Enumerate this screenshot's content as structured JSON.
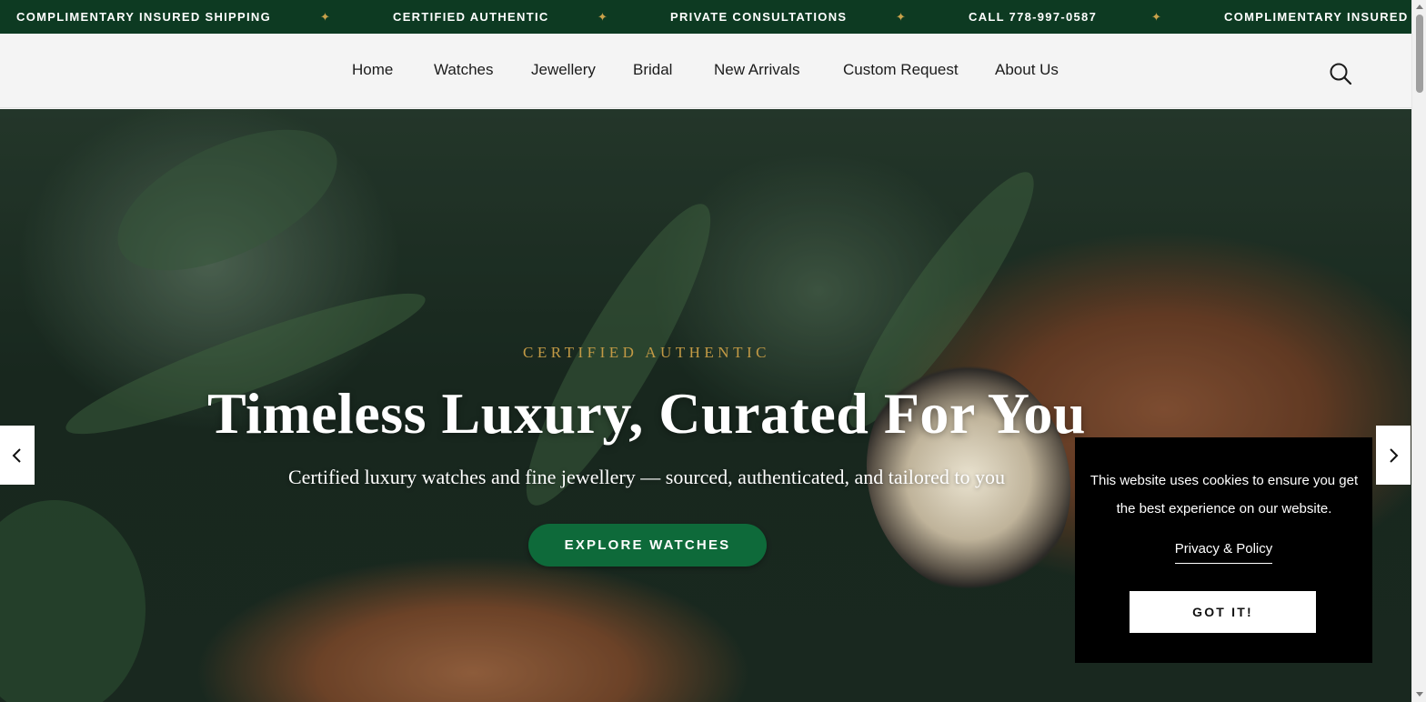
{
  "announcement": {
    "items": [
      "COMPLIMENTARY INSURED SHIPPING",
      "CERTIFIED AUTHENTIC",
      "PRIVATE CONSULTATIONS",
      "CALL 778-997-0587",
      "COMPLIMENTARY INSURED S"
    ],
    "separator": "✦",
    "background": "#0d3a22",
    "separator_color": "#c9a24b"
  },
  "nav": {
    "items": [
      "Home",
      "Watches",
      "Jewellery",
      "Bridal",
      "New Arrivals",
      "Custom Request",
      "About Us"
    ],
    "search_icon": "search-icon"
  },
  "hero": {
    "eyebrow": "CERTIFIED AUTHENTIC",
    "headline": "Timeless Luxury, Curated For You",
    "subline": "Certified luxury watches and fine jewellery — sourced, authenticated, and tailored to you",
    "cta_label": "EXPLORE WATCHES",
    "cta_color": "#0e6a3a",
    "eyebrow_color": "#c29a45",
    "prev_icon": "chevron-left-icon",
    "next_icon": "chevron-right-icon"
  },
  "cookie": {
    "message": "This website uses cookies to ensure you get the best experience on our website.",
    "policy_link": "Privacy & Policy",
    "accept_label": "GOT IT!"
  }
}
